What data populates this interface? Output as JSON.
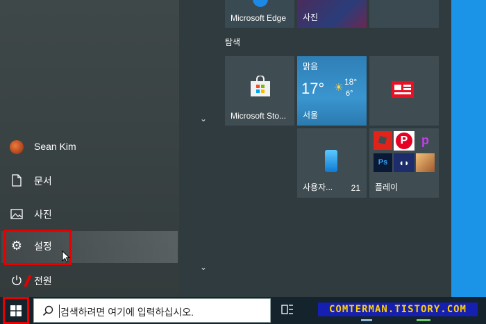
{
  "tiles": {
    "edge_label": "Microsoft Edge",
    "photos_label": "사진",
    "group_label": "탐색",
    "store_label": "Microsoft Sto...",
    "weather": {
      "condition": "맑음",
      "temp": "17°",
      "high": "18°",
      "low": "6°",
      "city": "서울"
    },
    "phone_label": "사용자...",
    "phone_badge": "21",
    "play_label": "플레이"
  },
  "menu": {
    "user": "Sean Kim",
    "documents": "문서",
    "pictures": "사진",
    "settings": "설정",
    "power": "전원"
  },
  "taskbar": {
    "search_placeholder": "검색하려면 여기에 입력하십시오.",
    "watermark": "COMTERMAN.TISTORY.COM"
  },
  "colors": {
    "highlight_box": "#e60000",
    "desktop": "#1b93e6"
  }
}
